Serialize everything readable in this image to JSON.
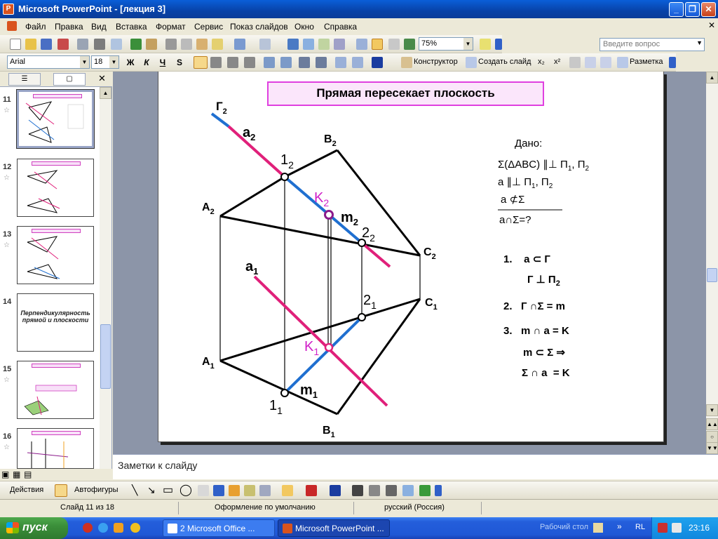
{
  "window": {
    "title": "Microsoft PowerPoint - [лекция 3]",
    "app_icon": "powerpoint-icon",
    "buttons": [
      "_",
      "❐",
      "✕"
    ]
  },
  "menu": {
    "items": [
      "Файл",
      "Правка",
      "Вид",
      "Вставка",
      "Формат",
      "Сервис",
      "Показ слайдов",
      "Окно",
      "Справка"
    ],
    "help_placeholder": "Введите вопрос"
  },
  "standard_toolbar": {
    "zoom": "75%"
  },
  "formatting_toolbar": {
    "font": "Arial",
    "size": "18",
    "bold": "Ж",
    "italic": "К",
    "underline": "Ч",
    "shadow": "S",
    "designer": "Конструктор",
    "new_slide": "Создать слайд",
    "layout": "Разметка"
  },
  "slides_panel": {
    "close": "✕",
    "thumbs": [
      {
        "num": "11",
        "selected": true,
        "title_text": ""
      },
      {
        "num": "12",
        "selected": false,
        "title_text": ""
      },
      {
        "num": "13",
        "selected": false,
        "title_text": ""
      },
      {
        "num": "14",
        "selected": false,
        "title_text": "Перпендикулярность прямой и плоскости"
      },
      {
        "num": "15",
        "selected": false,
        "title_text": ""
      },
      {
        "num": "16",
        "selected": false,
        "title_text": ""
      }
    ]
  },
  "slide": {
    "title": "Прямая пересекает плоскость",
    "labels": {
      "G2": "Г",
      "G2s": "2",
      "a2": "a",
      "a2s": "2",
      "B2": "B",
      "B2s": "2",
      "one2": "1",
      "one2s": "2",
      "A2": "A",
      "A2s": "2",
      "K2": "K",
      "K2s": "2",
      "m2": "m",
      "m2s": "2",
      "two2": "2",
      "two2s": "2",
      "C2": "C",
      "C2s": "2",
      "a1": "a",
      "a1s": "1",
      "two1": "2",
      "two1s": "1",
      "C1": "C",
      "C1s": "1",
      "K1": "K",
      "K1s": "1",
      "A1": "A",
      "A1s": "1",
      "m1": "m",
      "m1s": "1",
      "one1": "1",
      "one1s": "1",
      "B1": "B",
      "B1s": "1"
    },
    "given": {
      "header": "Дано:",
      "line1": "Σ(ΔABC) ∥⊥ П",
      "line1_tail": ", П",
      "line2": "a ∥⊥ П",
      "line2_tail": ", П",
      "line3": "a ⊄Σ",
      "line4": "a∩Σ=?",
      "sub1": "1",
      "sub2": "2"
    },
    "steps": {
      "s1a": "1.    a ⊂ Г",
      "s1b": "Г ⊥ П",
      "s1b_sub": "2",
      "s2": "2.   Г ∩Σ = m",
      "s3a": "3.   m ∩ a = K",
      "s3b": "m ⊂ Σ ⇒",
      "s3c": "Σ ∩ a  = K"
    },
    "colors": {
      "blue": "#1f6fd0",
      "magenta": "#e0207a",
      "purple": "#8b1a8b",
      "pink_label": "#d020c8"
    }
  },
  "notes": {
    "placeholder": "Заметки к слайду"
  },
  "draw_toolbar": {
    "actions": "Действия",
    "autoshapes": "Автофигуры"
  },
  "status": {
    "slide": "Слайд 11 из 18",
    "design": "Оформление по умолчанию",
    "language": "русский (Россия)"
  },
  "taskbar": {
    "start": "пуск",
    "task1": "2 Microsoft Office ...",
    "task2": "Microsoft PowerPoint ...",
    "desktop": "Рабочий стол",
    "lang": "RL",
    "clock": "23:16"
  }
}
